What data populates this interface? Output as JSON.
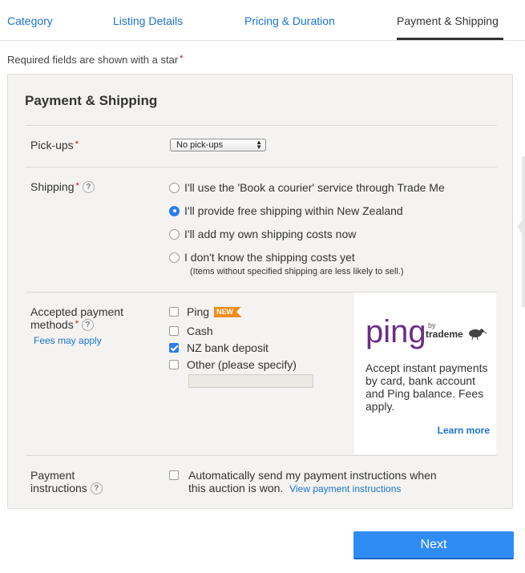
{
  "tabs": [
    {
      "label": "Category",
      "active": false
    },
    {
      "label": "Listing Details",
      "active": false
    },
    {
      "label": "Pricing & Duration",
      "active": false
    },
    {
      "label": "Payment & Shipping",
      "active": true
    }
  ],
  "required_note": "Required fields are shown with a star",
  "required_star": "*",
  "panel": {
    "title": "Payment & Shipping",
    "pickups": {
      "label": "Pick-ups",
      "star": "*",
      "selected": "No pick-ups"
    },
    "shipping": {
      "label": "Shipping",
      "star": "*",
      "help": "?",
      "options": [
        {
          "label": "I'll use the 'Book a courier' service through Trade Me",
          "checked": false
        },
        {
          "label": "I'll provide free shipping within New Zealand",
          "checked": true
        },
        {
          "label": "I'll add my own shipping costs now",
          "checked": false
        },
        {
          "label": "I don't know the shipping costs yet",
          "checked": false
        }
      ],
      "note": "(Items without specified shipping are less likely to sell.)"
    },
    "payment_methods": {
      "label_line1": "Accepted payment",
      "label_line2": "methods",
      "star": "*",
      "help": "?",
      "fees_link": "Fees may apply",
      "options": [
        {
          "label": "Ping",
          "checked": false,
          "badge": "NEW"
        },
        {
          "label": "Cash",
          "checked": false
        },
        {
          "label": "NZ bank deposit",
          "checked": true
        },
        {
          "label": "Other (please specify)",
          "checked": false
        }
      ],
      "other_value": ""
    },
    "ping_ad": {
      "logo_text": "ping",
      "by_text": "by",
      "brand_text": "trademe",
      "description": "Accept instant payments by card, bank account and Ping balance. Fees apply.",
      "learn_more": "Learn more"
    },
    "payment_instructions": {
      "label_line1": "Payment",
      "label_line2": "instructions",
      "help": "?",
      "checked": false,
      "text": "Automatically send my payment instructions when this auction is won.",
      "view_link": "View payment instructions"
    }
  },
  "next_button": "Next",
  "colors": {
    "link": "#1a73cf",
    "primary_button": "#2f8cf5",
    "required_star": "#d0021b",
    "ping_purple": "#6b2d86",
    "new_badge": "#f08c16"
  },
  "icons": {
    "help": "question-circle-icon",
    "select_arrows": "up-down-arrows-icon",
    "kiwi": "kiwi-bird-icon"
  }
}
